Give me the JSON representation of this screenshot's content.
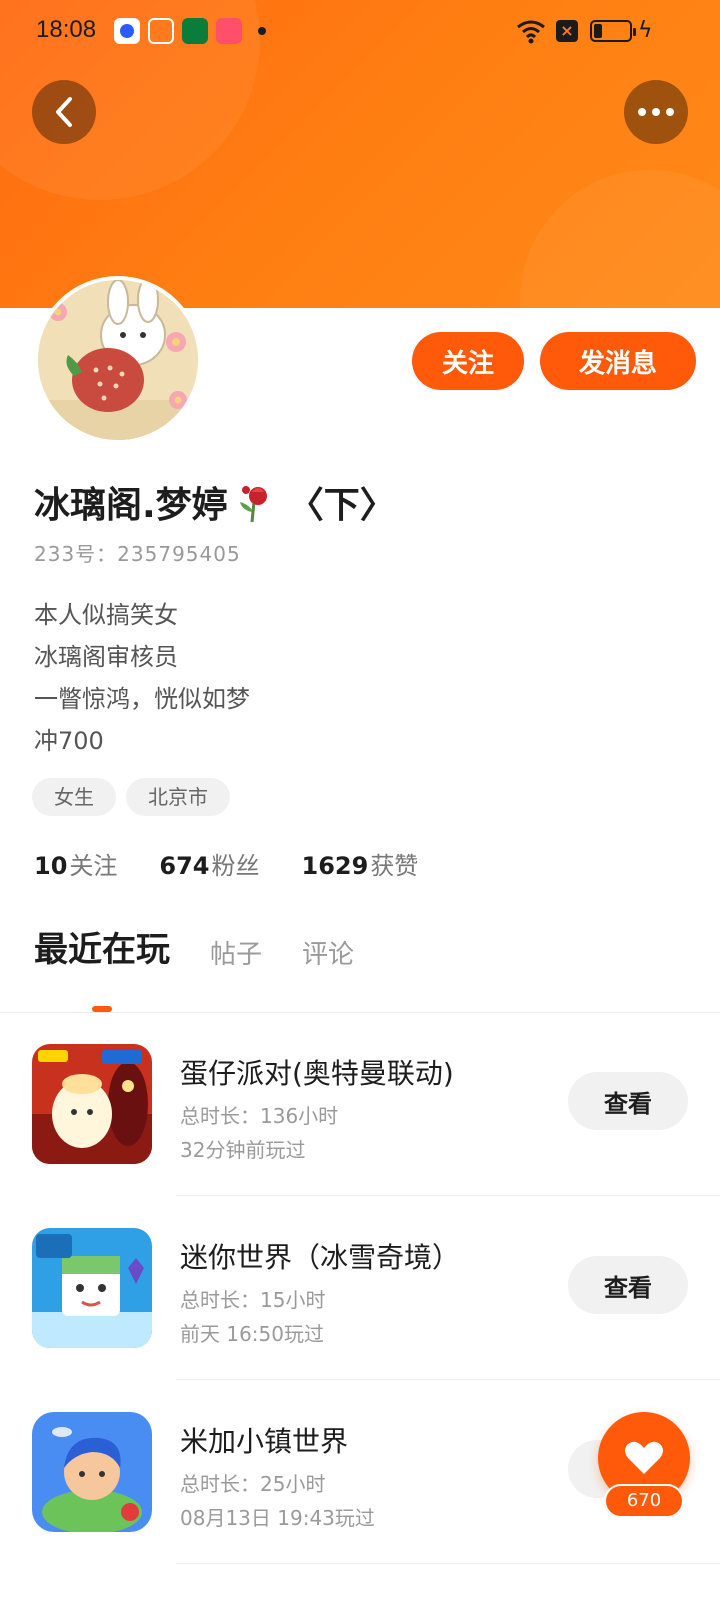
{
  "status_bar": {
    "time": "18:08",
    "icons": [
      "baidu-app-icon",
      "app-icon",
      "oppo-app-icon",
      "music-app-icon",
      "notification-dot",
      "wifi-icon",
      "x-icon",
      "battery-icon",
      "charging-icon"
    ]
  },
  "header": {
    "back_icon": "chevron-left-icon",
    "more_icon": "more-dots-icon",
    "colors": {
      "banner": "#ff7a12",
      "accent": "#ff5a0a"
    }
  },
  "profile": {
    "name": "冰璃阁.梦婷",
    "name_suffix": "〈下〉",
    "uid": "233号：235795405",
    "follow_label": "关注",
    "message_label": "发消息",
    "bio": [
      "本人似搞笑女",
      "冰璃阁审核员",
      "一瞥惊鸿，恍似如梦",
      "冲700"
    ],
    "tags": [
      "女生",
      "北京市"
    ],
    "stats": [
      {
        "num": "10",
        "label": "关注"
      },
      {
        "num": "674",
        "label": "粉丝"
      },
      {
        "num": "1629",
        "label": "获赞"
      }
    ]
  },
  "tabs": [
    {
      "label": "最近在玩",
      "active": true
    },
    {
      "label": "帖子",
      "active": false
    },
    {
      "label": "评论",
      "active": false
    }
  ],
  "games": [
    {
      "title": "蛋仔派对(奥特曼联动)",
      "duration": "总时长：136小时",
      "last_played": "32分钟前玩过",
      "button": "查看",
      "icon": "eggy-party-icon"
    },
    {
      "title": "迷你世界（冰雪奇境）",
      "duration": "总时长：15小时",
      "last_played": "前天 16:50玩过",
      "button": "查看",
      "icon": "mini-world-icon"
    },
    {
      "title": "米加小镇世界",
      "duration": "总时长：25小时",
      "last_played": "08月13日 19:43玩过",
      "button": "查看",
      "icon": "miga-town-icon"
    }
  ],
  "like_fab": {
    "count": "670",
    "icon": "heart-icon"
  }
}
